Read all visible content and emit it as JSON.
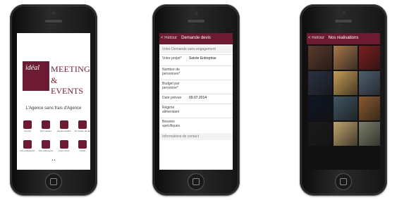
{
  "phone1": {
    "logo_small": "idéal",
    "logo_line1": "MEETINGS",
    "logo_line2": "& EVENTS",
    "tagline": "L'Agence sans frais d'Agence",
    "menu": [
      {
        "label": "Accueil"
      },
      {
        "label": "Nos métiers"
      },
      {
        "label": "Equipe dédiée"
      },
      {
        "label": "Demande de devis"
      },
      {
        "label": "Nos réalisations"
      },
      {
        "label": "Nos références"
      },
      {
        "label": "Nous situer"
      },
      {
        "label": "Twitter"
      }
    ]
  },
  "phone2": {
    "nav_back": "< Retour",
    "nav_title": "Demande devis",
    "section1": "Votre Demande sans engagement",
    "rows": [
      {
        "label": "Votre projet*",
        "value": "Soirée Entreprise"
      },
      {
        "label": "Nombre de personnes*",
        "value": ""
      },
      {
        "label": "Budget par personne*",
        "value": ""
      },
      {
        "label": "Date prévue",
        "value": "09.07.2014"
      },
      {
        "label": "Régime alimentaire",
        "value": ""
      },
      {
        "label": "Besoins spécifiques",
        "value": ""
      }
    ],
    "section2": "Informations de contact"
  },
  "phone3": {
    "nav_back": "< Retour",
    "nav_title": "Nos réalisations",
    "colors": [
      "#5b3a2c",
      "#a7764b",
      "#7b1f1f",
      "#2a3142",
      "#c69c55",
      "#4f5f6f",
      "#0f1626",
      "#3f5561",
      "#8a5a2f",
      "#1b1b1b",
      "#c0a36e",
      "#7b7f6a"
    ]
  }
}
